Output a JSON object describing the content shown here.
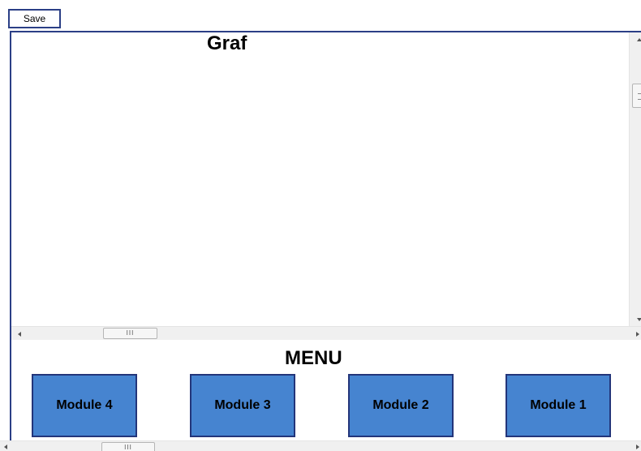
{
  "toolbar": {
    "save_label": "Save"
  },
  "graf_panel": {
    "title": "Graf",
    "hscroll_thumb_grip": "III"
  },
  "menu_panel": {
    "title": "MENU",
    "modules": [
      {
        "label": "Module 4"
      },
      {
        "label": "Module 3"
      },
      {
        "label": "Module 2"
      },
      {
        "label": "Module 1"
      }
    ],
    "hscroll_thumb_grip": "III"
  },
  "colors": {
    "border": "#2b3f86",
    "module_fill": "#4684d0",
    "module_border": "#23357a",
    "scrollbar_track": "#f0f0f0"
  },
  "icons": [
    "scroll-up-arrow-icon",
    "scroll-down-arrow-icon",
    "scroll-left-arrow-icon",
    "scroll-right-arrow-icon"
  ]
}
